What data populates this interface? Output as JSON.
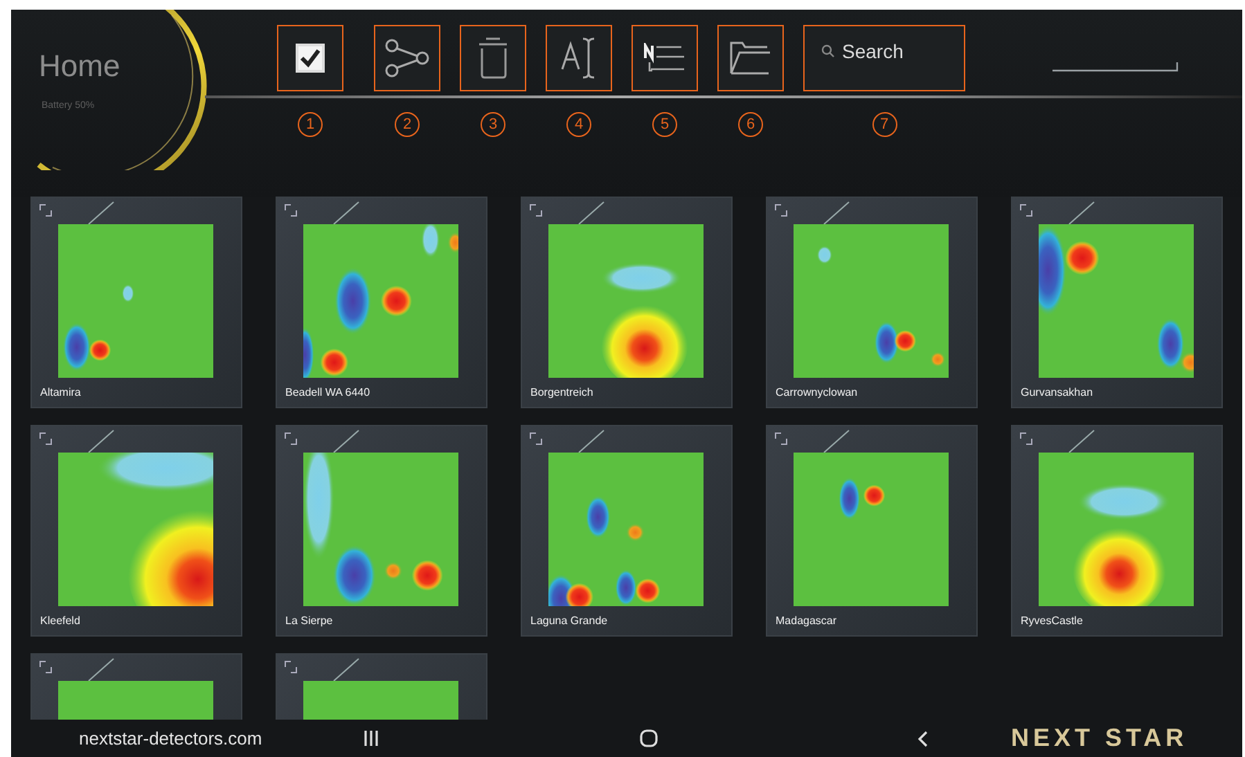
{
  "home": {
    "title": "Home",
    "battery": "Battery 50%"
  },
  "toolbar": [
    {
      "kind": "checkbox",
      "checked": true,
      "callout": "1"
    },
    {
      "kind": "share",
      "callout": "2"
    },
    {
      "kind": "trash",
      "callout": "3"
    },
    {
      "kind": "text",
      "callout": "4"
    },
    {
      "kind": "sort",
      "callout": "5"
    },
    {
      "kind": "folder",
      "callout": "6"
    },
    {
      "kind": "search",
      "placeholder": "Search",
      "callout": "7"
    }
  ],
  "tiles": [
    {
      "kind": "scan",
      "name": "Altamira"
    },
    {
      "kind": "scan",
      "name": "Beadell WA 6440"
    },
    {
      "kind": "scan",
      "name": "Borgentreich"
    },
    {
      "kind": "scan",
      "name": "Carrownyclowan"
    },
    {
      "kind": "scan",
      "name": "Gurvansakhan"
    },
    {
      "kind": "scan",
      "name": "Kleefeld"
    },
    {
      "kind": "scan",
      "name": "La Sierpe"
    },
    {
      "kind": "scan",
      "name": "Laguna Grande"
    },
    {
      "kind": "scan",
      "name": "Madagascar"
    },
    {
      "kind": "scan",
      "name": "RyvesCastle"
    },
    {
      "kind": "partial"
    },
    {
      "kind": "partial"
    }
  ],
  "footer": {
    "website": "nextstar-detectors.com",
    "logo": "NEXT STAR"
  }
}
